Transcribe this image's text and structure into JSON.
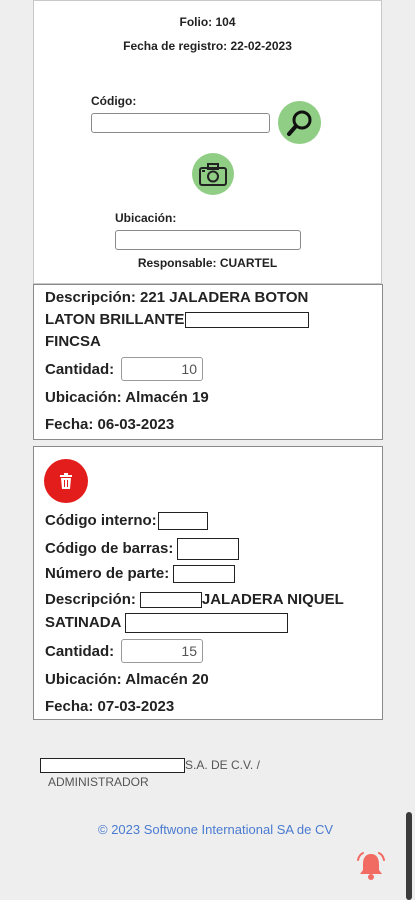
{
  "header": {
    "folio": "Folio: 104",
    "fecha_registro": "Fecha de registro: 22-02-2023"
  },
  "form": {
    "codigo_label": "Código:",
    "codigo_value": "",
    "search_icon": "magnifier-icon",
    "camera_icon": "camera-icon",
    "ubicacion_label": "Ubicación:",
    "ubicacion_value": "",
    "responsable": "Responsable: CUARTEL"
  },
  "items": [
    {
      "descripcion_line1": "Descripción: 221 JALADERA BOTON",
      "descripcion_line2": "LATON BRILLANTE",
      "descripcion_line3": "FINCSA",
      "cantidad_label": "Cantidad:",
      "cantidad": "10",
      "ubicacion": "Ubicación: Almacén 19",
      "fecha": "Fecha: 06-03-2023"
    },
    {
      "delete_icon": "trash-icon",
      "codigo_interno_label": "Código interno:",
      "codigo_barras_label": "Código de barras:",
      "numero_parte_label": "Número de parte:",
      "descripcion_label": "Descripción:",
      "descripcion_text": "JALADERA NIQUEL",
      "descripcion_line2": "SATINADA",
      "cantidad_label": "Cantidad:",
      "cantidad": "15",
      "ubicacion": "Ubicación: Almacén 20",
      "fecha": "Fecha: 07-03-2023"
    }
  ],
  "footer": {
    "company_suffix": "S.A. DE C.V. /",
    "role": "ADMINISTRADOR",
    "copyright": "© 2023 Softwone International SA de CV",
    "bell_icon": "bell-icon",
    "colors": {
      "accent_green": "#8fce84",
      "delete_red": "#e31c1c",
      "link_blue": "#4a7bd0",
      "bell_red": "#f26b63"
    }
  }
}
